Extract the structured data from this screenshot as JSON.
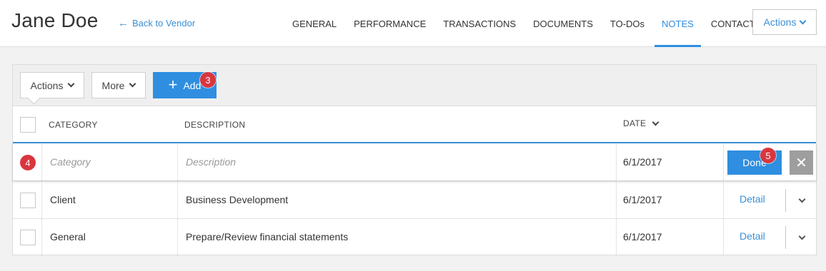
{
  "header": {
    "title": "Jane Doe",
    "back_link": "Back to Vendor",
    "nav": [
      {
        "label": "GENERAL",
        "active": false
      },
      {
        "label": "PERFORMANCE",
        "active": false
      },
      {
        "label": "TRANSACTIONS",
        "active": false
      },
      {
        "label": "DOCUMENTS",
        "active": false
      },
      {
        "label": "TO-DOs",
        "active": false
      },
      {
        "label": "NOTES",
        "active": true
      },
      {
        "label": "CONTACTS",
        "active": false
      }
    ],
    "actions_label": "Actions"
  },
  "toolbar": {
    "actions_label": "Actions",
    "more_label": "More",
    "add_label": "Add",
    "add_badge": "3"
  },
  "table": {
    "columns": {
      "category": "CATEGORY",
      "description": "DESCRIPTION",
      "date": "DATE"
    },
    "edit_row": {
      "badge": "4",
      "category_placeholder": "Category",
      "description_placeholder": "Description",
      "date": "6/1/2017",
      "done_label": "Done",
      "done_badge": "5"
    },
    "rows": [
      {
        "category": "Client",
        "description": "Business Development",
        "date": "6/1/2017",
        "action": "Detail"
      },
      {
        "category": "General",
        "description": "Prepare/Review financial statements",
        "date": "6/1/2017",
        "action": "Detail"
      }
    ]
  },
  "colors": {
    "accent": "#2f8ee0",
    "badge": "#d9363e"
  }
}
